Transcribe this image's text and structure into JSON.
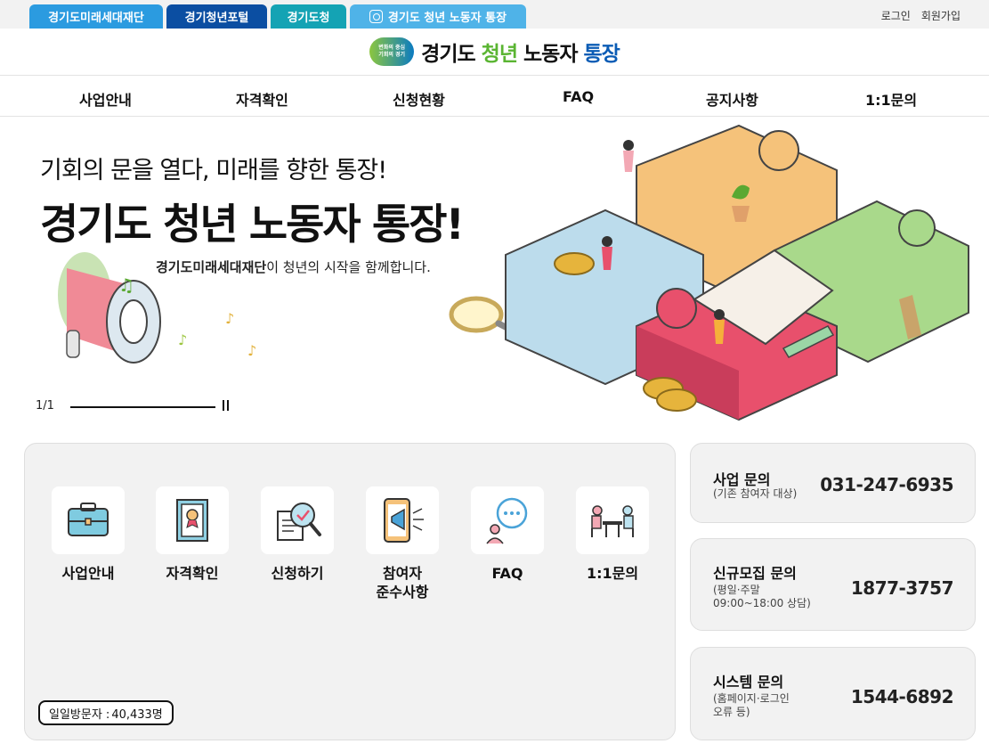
{
  "topbar": {
    "tabs": [
      {
        "label": "경기도미래세대재단"
      },
      {
        "label": "경기청년포털"
      },
      {
        "label": "경기도청"
      },
      {
        "label": "경기도 청년 노동자 통장"
      }
    ],
    "login": "로그인",
    "signup": "회원가입"
  },
  "logo": {
    "badge_line1": "변화의 중심",
    "badge_line2": "기회의 경기",
    "part1": "경기도",
    "part2": "청년",
    "part3": "노동자",
    "part4": "통장"
  },
  "nav": {
    "items": [
      {
        "label": "사업안내"
      },
      {
        "label": "자격확인"
      },
      {
        "label": "신청현황"
      },
      {
        "label": "FAQ"
      },
      {
        "label": "공지사항"
      },
      {
        "label": "1:1문의"
      }
    ]
  },
  "hero": {
    "subtitle": "기회의 문을 열다, 미래를 향한 통장!",
    "title": "경기도 청년 노동자 통장!",
    "desc_bold": "경기도미래세대재단",
    "desc_rest": "이 청년의 시작을 함께합니다.",
    "slide_counter": "1/1"
  },
  "quick": {
    "items": [
      {
        "label": "사업안내"
      },
      {
        "label": "자격확인"
      },
      {
        "label": "신청하기"
      },
      {
        "label": "참여자\n준수사항"
      },
      {
        "label": "FAQ"
      },
      {
        "label": "1:1문의"
      }
    ],
    "visitor_label": "일일방문자 :",
    "visitor_count": "40,433명"
  },
  "contacts": [
    {
      "title": "사업 문의",
      "note": "(기존 참여자 대상)",
      "phone": "031-247-6935"
    },
    {
      "title": "신규모집 문의",
      "note": "(평일·주말\n 09:00~18:00 상담)",
      "phone": "1877-3757"
    },
    {
      "title": "시스템 문의",
      "note": "(홈페이지·로그인\n 오류 등)",
      "phone": "1544-6892"
    }
  ],
  "colors": {
    "tab1": "#2b9be0",
    "tab2": "#0b4ea2",
    "tab3": "#14a3b4",
    "tab4": "#4fb3e8",
    "panel_bg": "#f2f2f2",
    "logo_green": "#5ab532",
    "logo_blue": "#0b5cb5"
  },
  "icons": [
    "instagram-icon",
    "briefcase-icon",
    "certificate-icon",
    "search-document-icon",
    "megaphone-phone-icon",
    "chat-bubble-icon",
    "counseling-table-icon",
    "pause-icon"
  ]
}
